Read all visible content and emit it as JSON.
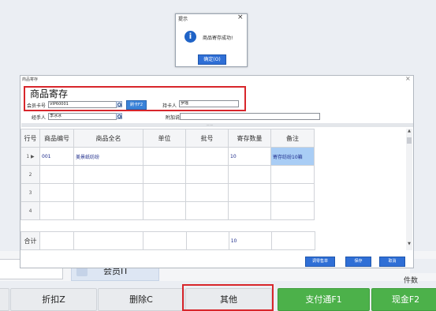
{
  "background": {
    "vip_button_label": "会员IT",
    "count_label": "件数",
    "buttons": {
      "discount": "折扣Z",
      "delete": "删除C",
      "other": "其他",
      "pay": "支付通F1",
      "cash": "现金F2"
    },
    "colors": {
      "primary_green": "#4cb14a",
      "highlight_red": "#d8262b"
    }
  },
  "prompt": {
    "title": "提示",
    "close": "×",
    "message": "商品寄存成功!",
    "ok_label": "确定(O)"
  },
  "dialog": {
    "title": "商品寄存",
    "close": "×",
    "heading": "商品寄存",
    "form": {
      "member_card_label": "会员卡号",
      "member_card_value": "VIP60001",
      "swipe_button": "刷卡F2",
      "holder_label": "持卡人",
      "holder_value": "罗瑶",
      "operator_label": "经手人",
      "operator_value": "李冰冰",
      "remark_label": "附加说明",
      "remark_value": ""
    },
    "grid": {
      "headers": [
        "行号",
        "商品编号",
        "商品全名",
        "单位",
        "批号",
        "寄存数量",
        "备注"
      ],
      "rows": [
        {
          "row": "1",
          "code": "001",
          "name": "美景纸纺纷",
          "unit": "",
          "batch": "",
          "qty": "10",
          "note": "寄存纺纷10箱"
        },
        {
          "row": "2",
          "code": "",
          "name": "",
          "unit": "",
          "batch": "",
          "qty": "",
          "note": ""
        },
        {
          "row": "3",
          "code": "",
          "name": "",
          "unit": "",
          "batch": "",
          "qty": "",
          "note": ""
        },
        {
          "row": "4",
          "code": "",
          "name": "",
          "unit": "",
          "batch": "",
          "qty": "",
          "note": ""
        }
      ],
      "total_label": "合计",
      "total_qty": "10"
    },
    "footer": {
      "adjust": "调零售单",
      "save": "保存",
      "cancel": "取消"
    }
  }
}
